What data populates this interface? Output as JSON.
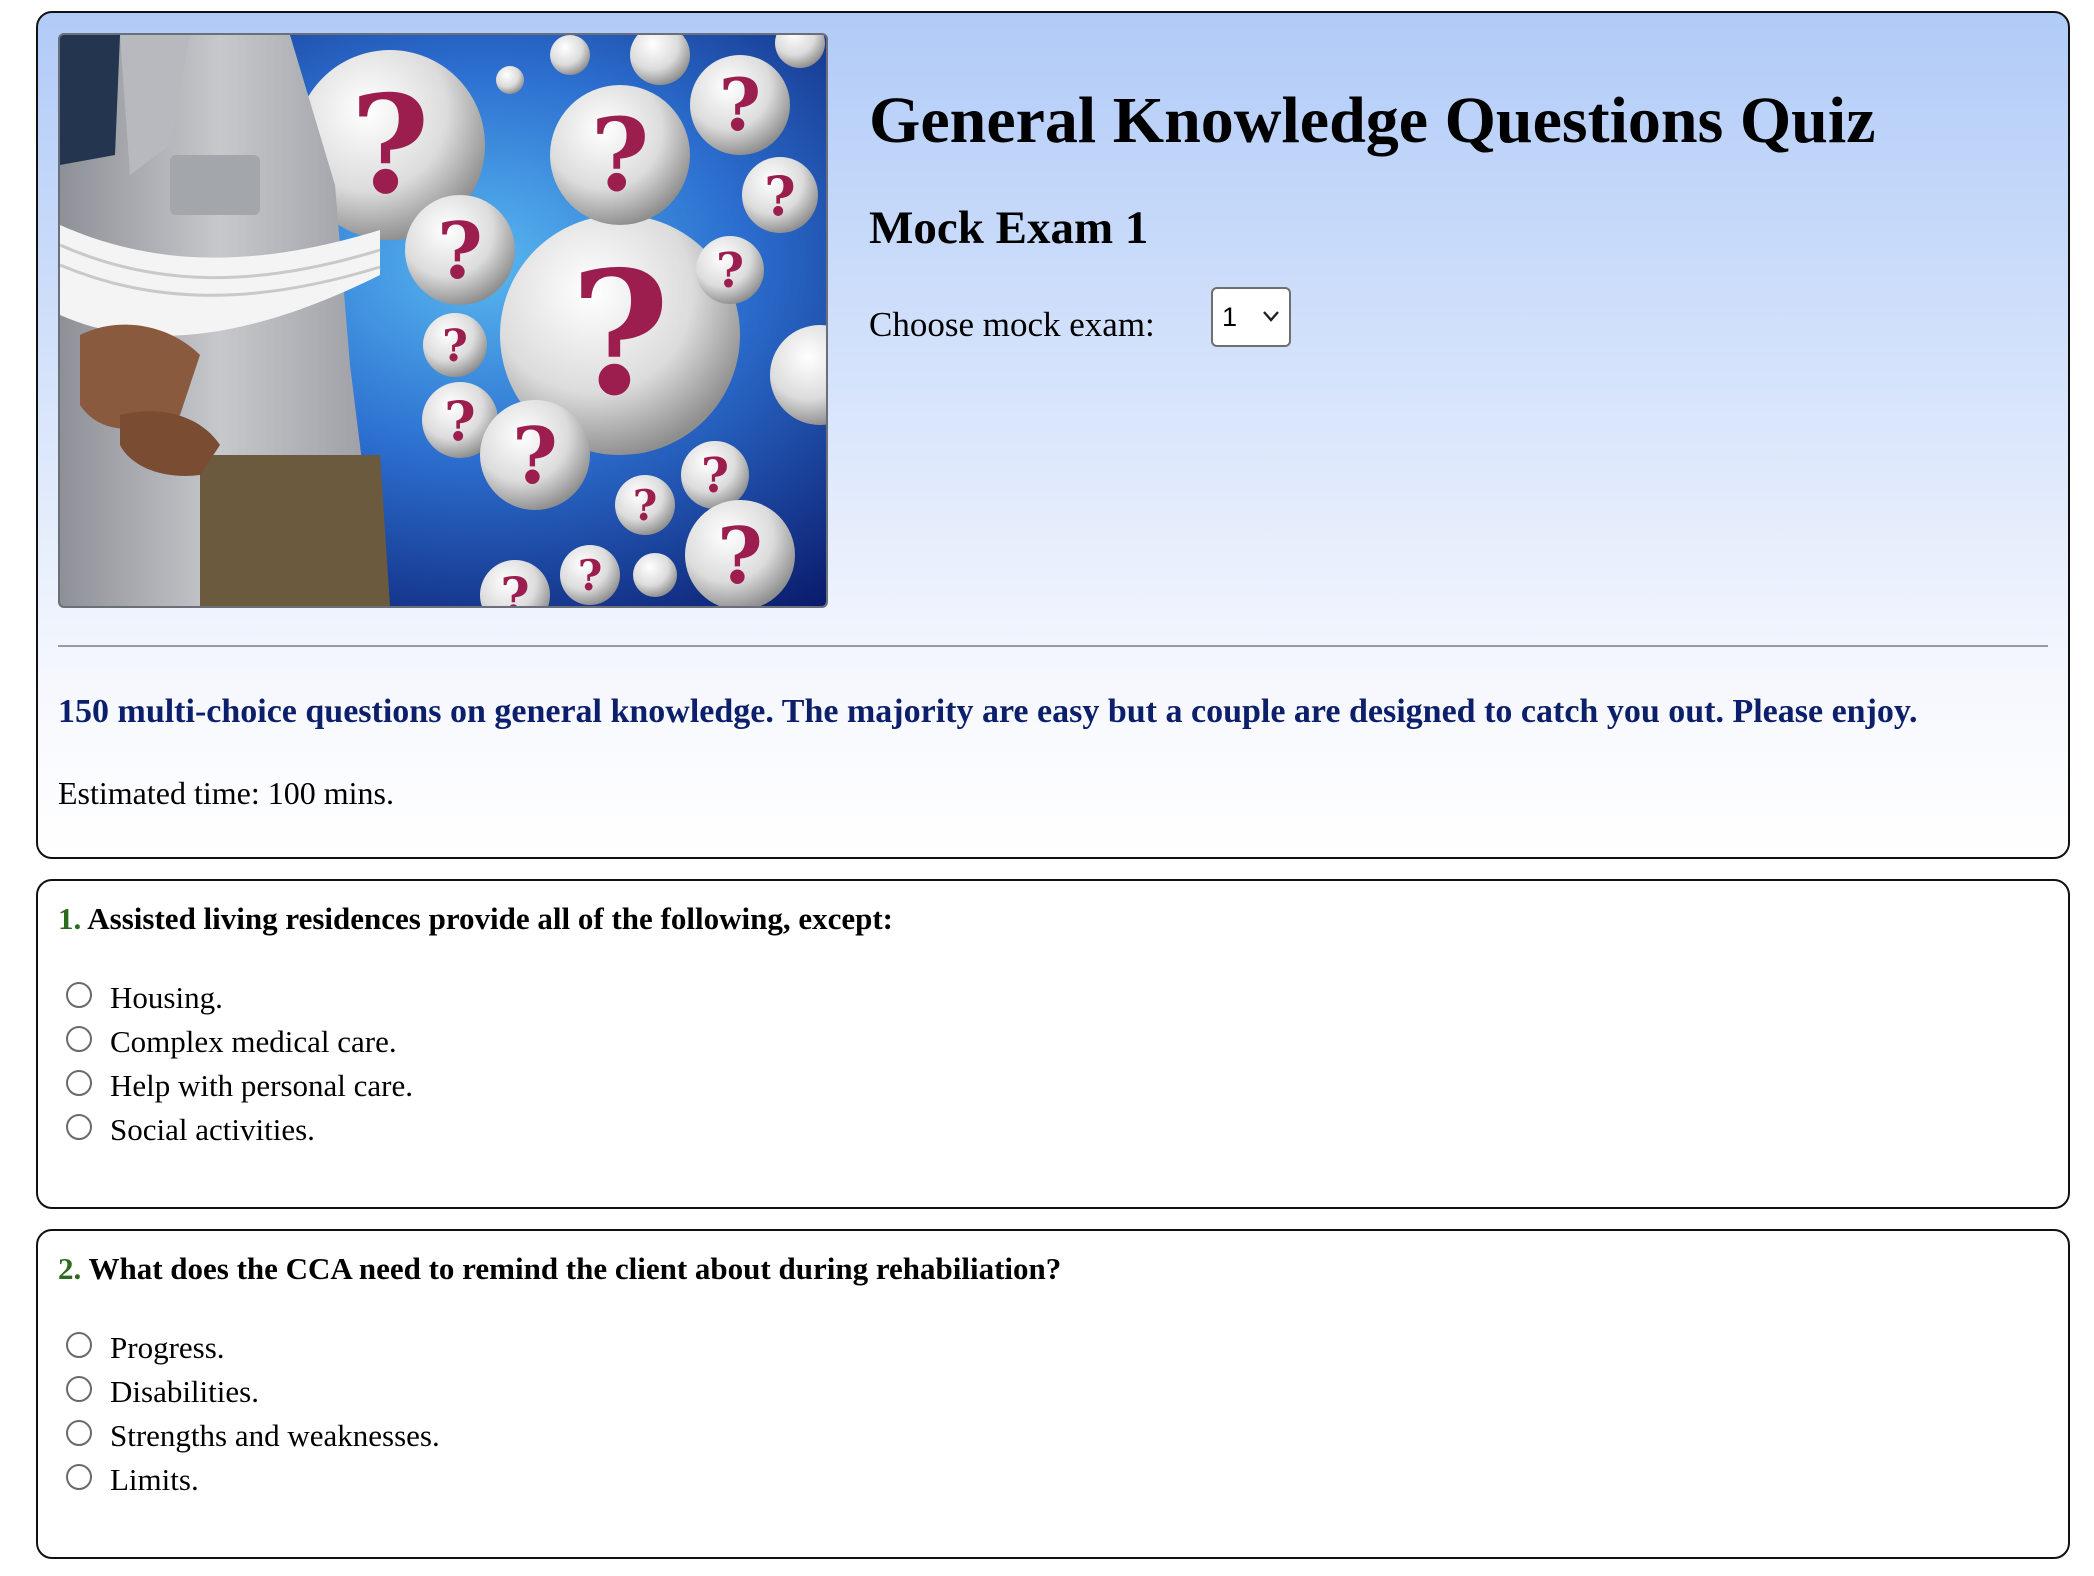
{
  "header": {
    "hero_image": {
      "alt": "",
      "icon": "question-mark-bubbles-image"
    },
    "title": "General Knowledge Questions Quiz",
    "subtitle": "Mock Exam 1",
    "mock_select": {
      "label": "Choose mock exam:",
      "selected": "1"
    },
    "intro": "150 multi-choice questions on general knowledge. The majority are easy but a couple are designed to catch you out. Please enjoy.",
    "estimated_time": "Estimated time: 100 mins."
  },
  "questions": [
    {
      "number": "1.",
      "text": "Assisted living residences provide all of the following, except:",
      "options": [
        "Housing.",
        "Complex medical care.",
        "Help with personal care.",
        "Social activities."
      ]
    },
    {
      "number": "2.",
      "text": "What does the CCA need to remind the client about during rehabiliation?",
      "options": [
        "Progress.",
        "Disabilities.",
        "Strengths and weaknesses.",
        "Limits."
      ]
    }
  ],
  "colors": {
    "header_gradient_top": "#b1cbf8",
    "intro_text": "#0c1f6b",
    "question_number": "#2a6b1e",
    "card_border": "#111111"
  }
}
